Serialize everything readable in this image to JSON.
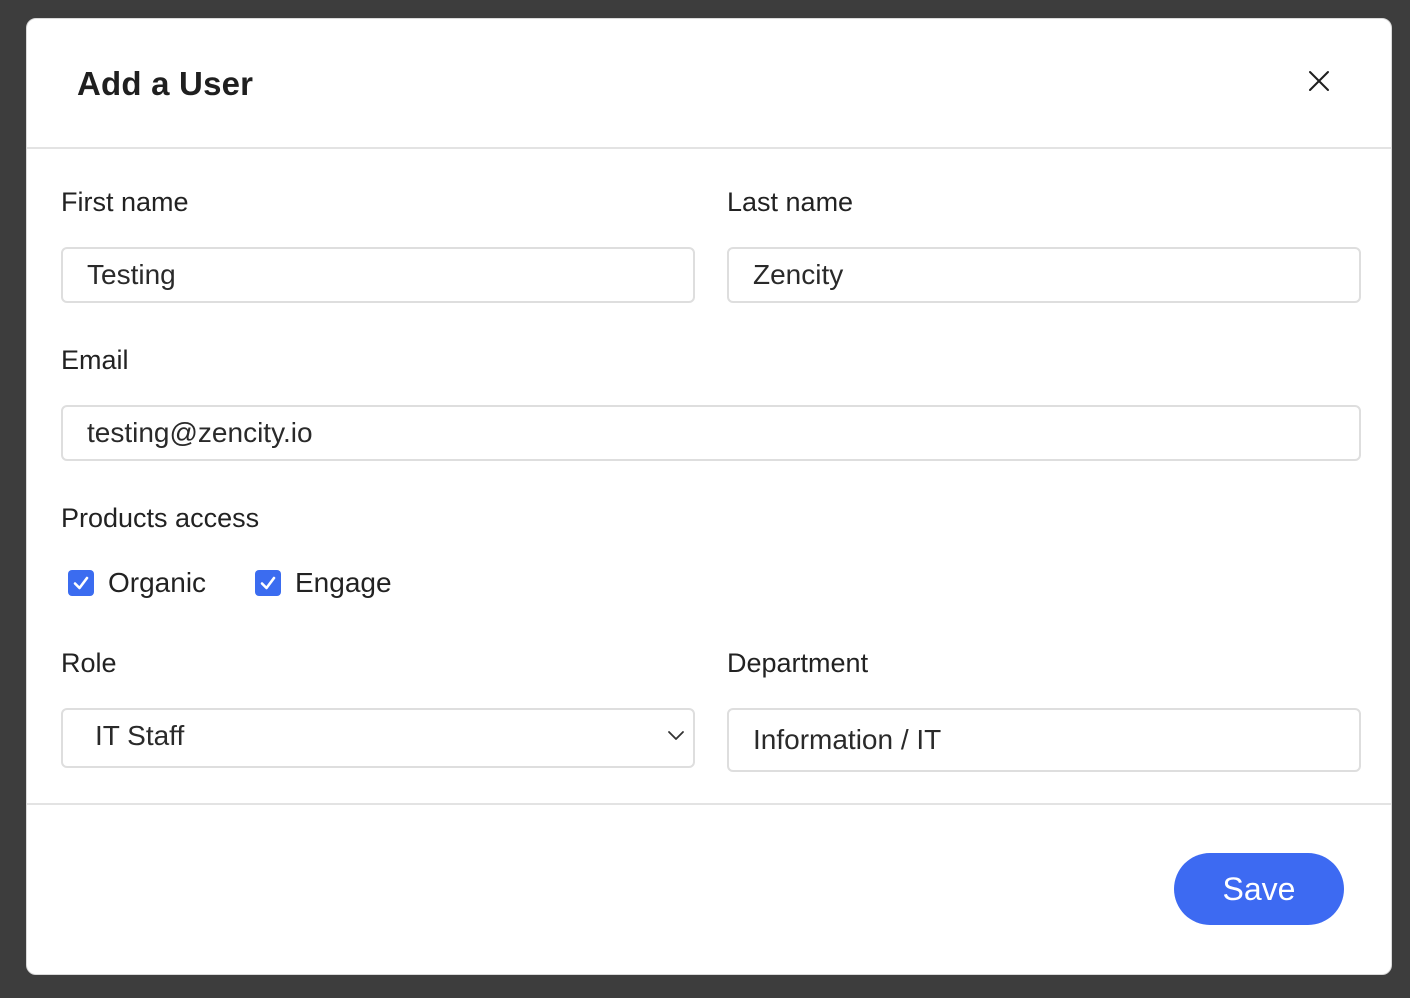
{
  "dialog": {
    "title": "Add a User",
    "close_icon": "close-icon"
  },
  "form": {
    "first_name": {
      "label": "First name",
      "value": "Testing"
    },
    "last_name": {
      "label": "Last name",
      "value": "Zencity"
    },
    "email": {
      "label": "Email",
      "value": "testing@zencity.io"
    },
    "products_access": {
      "label": "Products access",
      "options": [
        {
          "label": "Organic",
          "checked": true
        },
        {
          "label": "Engage",
          "checked": true
        }
      ]
    },
    "role": {
      "label": "Role",
      "value": "IT Staff",
      "icon": "chevron-down-icon"
    },
    "department": {
      "label": "Department",
      "value": "Information / IT"
    }
  },
  "footer": {
    "save_label": "Save"
  },
  "colors": {
    "accent": "#3d6af2",
    "checkbox": "#3b6cf0",
    "backdrop": "#3d3d3d"
  }
}
